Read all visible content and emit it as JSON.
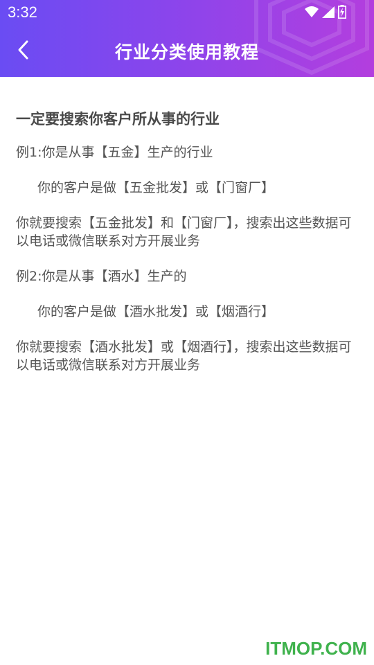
{
  "status_bar": {
    "time": "3:32"
  },
  "header": {
    "title": "行业分类使用教程",
    "back_icon": "chevron-left-icon"
  },
  "content": {
    "heading": "一定要搜索你客户所从事的行业",
    "paragraphs": [
      "例1:你是从事【五金】生产的行业",
      "你的客户是做【五金批发】或【门窗厂】",
      "你就要搜索【五金批发】和【门窗厂】，搜索出这些数据可以电话或微信联系对方开展业务",
      "例2:你是从事【酒水】生产的",
      "你的客户是做【酒水批发】或【烟酒行】",
      "你就要搜索【酒水批发】或【烟酒行】，搜索出这些数据可以电话或微信联系对方开展业务"
    ]
  },
  "watermark": "ITMOP.COM",
  "colors": {
    "header_gradient_start": "#6a4cf3",
    "header_gradient_end": "#b33ede",
    "watermark": "#3fb24d"
  }
}
